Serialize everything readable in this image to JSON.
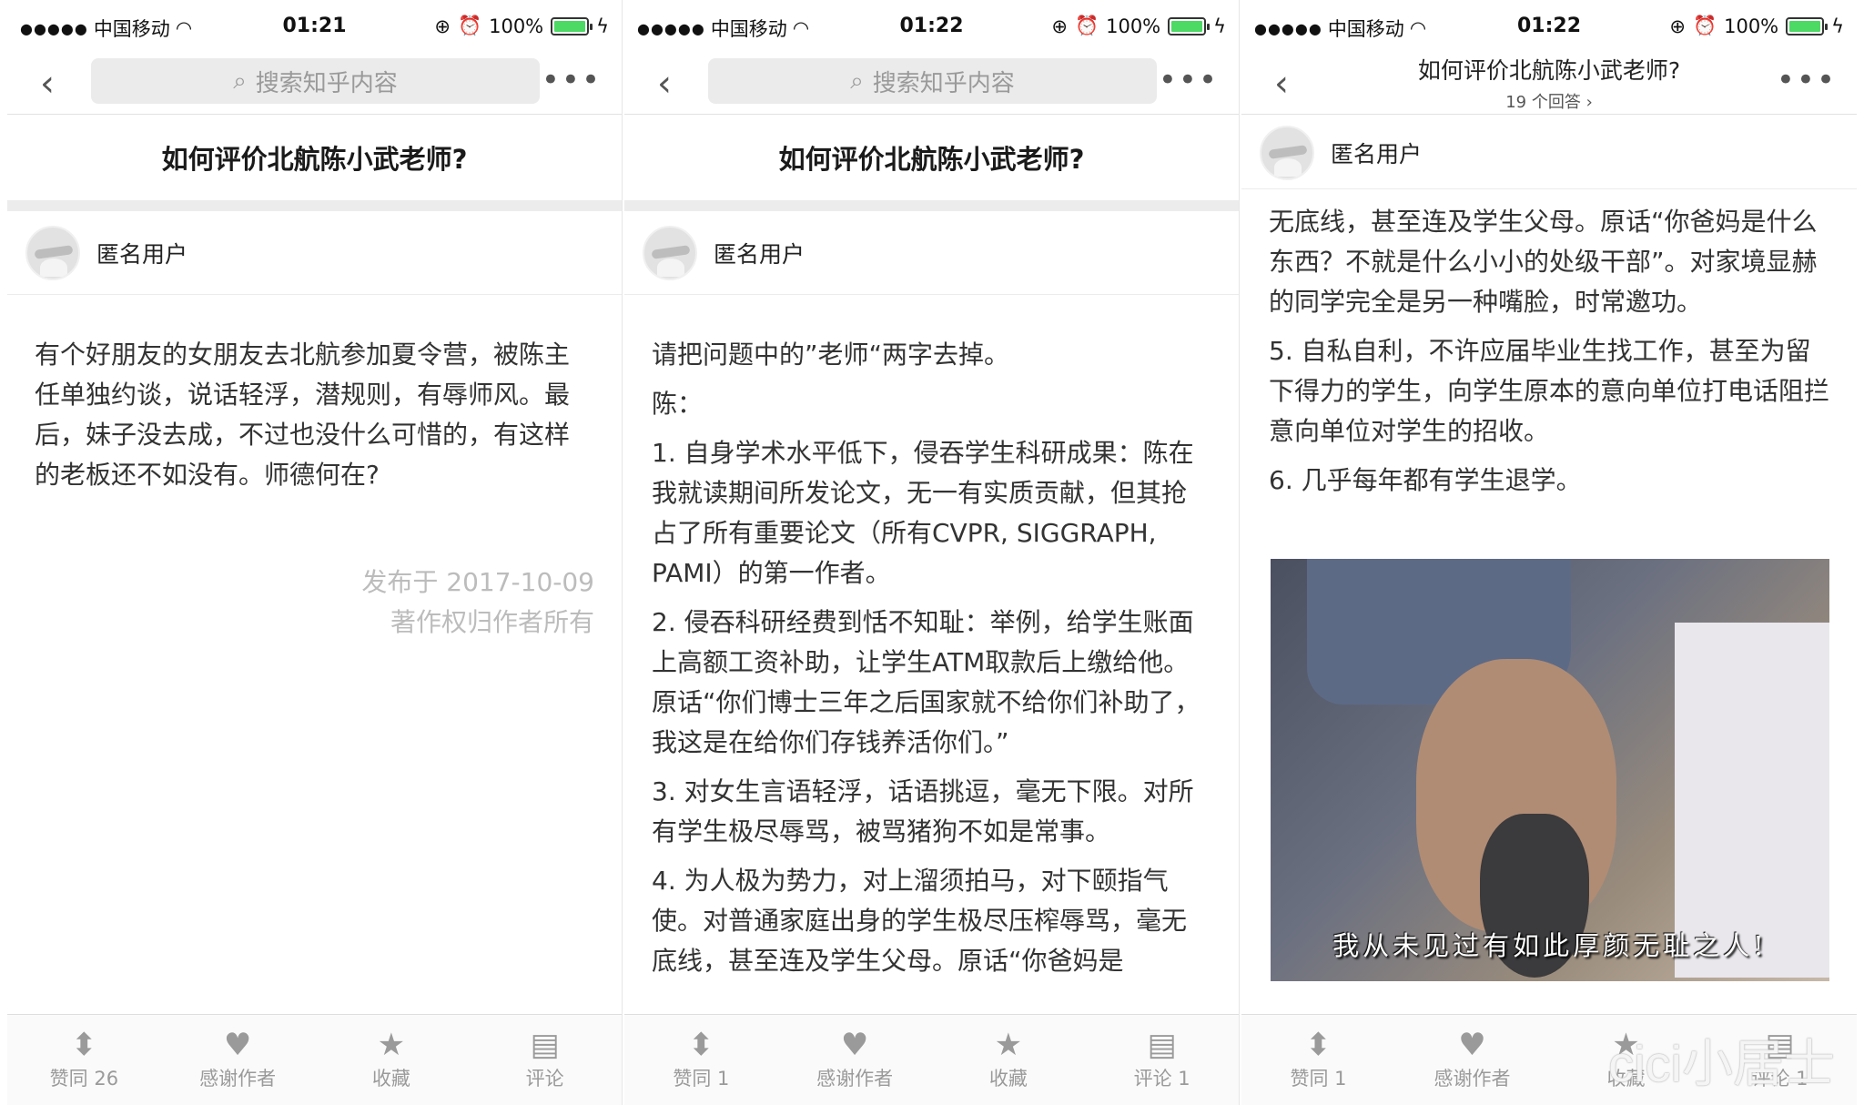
{
  "status": {
    "carrier": "中国移动",
    "battery": "100%",
    "battery_level": 1.0,
    "times": [
      "01:21",
      "01:22",
      "01:22"
    ]
  },
  "search": {
    "placeholder": "搜索知乎内容"
  },
  "question": {
    "title": "如何评价北航陈小武老师?",
    "answer_count": "19 个回答 ›"
  },
  "author": {
    "name": "匿名用户"
  },
  "panel1": {
    "body": "有个好朋友的女朋友去北航参加夏令营，被陈主任单独约谈，说话轻浮，潜规则，有辱师风。最后，妹子没去成，不过也没什么可惜的，有这样的老板还不如没有。师德何在?",
    "published": "发布于 2017-10-09",
    "copyright": "著作权归作者所有",
    "actions": {
      "agree": "赞同 26",
      "thanks": "感谢作者",
      "collect": "收藏",
      "comment": "评论"
    }
  },
  "panel2": {
    "paragraphs": [
      "请把问题中的”老师“两字去掉。",
      "陈：",
      "1. 自身学术水平低下，侵吞学生科研成果：陈在我就读期间所发论文，无一有实质贡献，但其抢占了所有重要论文（所有CVPR, SIGGRAPH, PAMI）的第一作者。",
      "2. 侵吞科研经费到恬不知耻：举例，给学生账面上高额工资补助，让学生ATM取款后上缴给他。原话“你们博士三年之后国家就不给你们补助了，我这是在给你们存钱养活你们。”",
      "3. 对女生言语轻浮，话语挑逗，毫无下限。对所有学生极尽辱骂，被骂猪狗不如是常事。",
      "4. 为人极为势力，对上溜须拍马，对下颐指气使。对普通家庭出身的学生极尽压榨辱骂，毫无底线，甚至连及学生父母。原话“你爸妈是"
    ],
    "actions": {
      "agree": "赞同 1",
      "thanks": "感谢作者",
      "collect": "收藏",
      "comment": "评论 1"
    }
  },
  "panel3": {
    "paragraphs": [
      "无底线，甚至连及学生父母。原话“你爸妈是什么东西？不就是什么小小的处级干部”。对家境显赫的同学完全是另一种嘴脸，时常邀功。",
      "5. 自私自利，不许应届毕业生找工作，甚至为留下得力的学生，向学生原本的意向单位打电话阻拦意向单位对学生的招收。",
      "6. 几乎每年都有学生退学。"
    ],
    "meme_caption": "我从未见过有如此厚颜无耻之人!",
    "actions": {
      "agree": "赞同 1",
      "thanks": "感谢作者",
      "collect": "收藏",
      "comment": "评论 1"
    }
  },
  "watermark": "cici小居士"
}
